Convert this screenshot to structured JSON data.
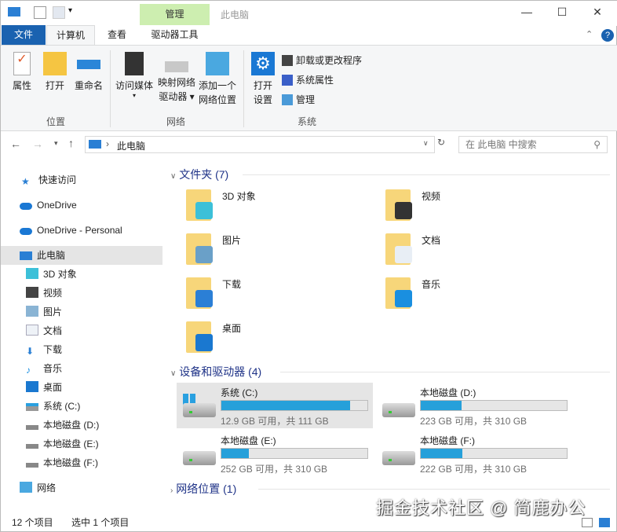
{
  "title_bar": {
    "contextual_tab_group": "管理",
    "window_title": "此电脑",
    "minimize": "—",
    "maximize": "☐",
    "close": "✕"
  },
  "ribbon_tabs": {
    "file": "文件",
    "computer": "计算机",
    "view": "查看",
    "drive_tools": "驱动器工具"
  },
  "ribbon": {
    "location": {
      "label": "位置",
      "properties": "属性",
      "open": "打开",
      "rename": "重命名"
    },
    "network": {
      "label": "网络",
      "access_media": "访问媒体",
      "map_drive_1": "映射网络",
      "map_drive_2": "驱动器",
      "add_location_1": "添加一个",
      "add_location_2": "网络位置"
    },
    "system": {
      "label": "系统",
      "open_settings_1": "打开",
      "open_settings_2": "设置",
      "uninstall": "卸载或更改程序",
      "system_properties": "系统属性",
      "manage": "管理"
    }
  },
  "address": {
    "path": "此电脑",
    "search_placeholder": "在 此电脑 中搜索"
  },
  "nav": {
    "items": [
      {
        "label": "快速访问"
      },
      {
        "label": "OneDrive"
      },
      {
        "label": "OneDrive - Personal"
      },
      {
        "label": "此电脑"
      },
      {
        "label": "3D 对象"
      },
      {
        "label": "视频"
      },
      {
        "label": "图片"
      },
      {
        "label": "文档"
      },
      {
        "label": "下载"
      },
      {
        "label": "音乐"
      },
      {
        "label": "桌面"
      },
      {
        "label": "系统 (C:)"
      },
      {
        "label": "本地磁盘 (D:)"
      },
      {
        "label": "本地磁盘 (E:)"
      },
      {
        "label": "本地磁盘 (F:)"
      },
      {
        "label": "网络"
      }
    ]
  },
  "folders": {
    "header": "文件夹 (7)",
    "items": [
      {
        "name": "3D 对象",
        "color": "#3cc0d8"
      },
      {
        "name": "视频",
        "color": "#333"
      },
      {
        "name": "图片",
        "color": "#6aa0c8"
      },
      {
        "name": "文档",
        "color": "#e8eef5"
      },
      {
        "name": "下载",
        "color": "#2b7fd6"
      },
      {
        "name": "音乐",
        "color": "#1a8fe0"
      },
      {
        "name": "桌面",
        "color": "#1a78d0"
      }
    ]
  },
  "drives": {
    "header": "设备和驱动器 (4)",
    "items": [
      {
        "name": "系统 (C:)",
        "free": "12.9 GB 可用，共 111 GB",
        "used_pct": 88.4
      },
      {
        "name": "本地磁盘 (D:)",
        "free": "223 GB 可用，共 310 GB",
        "used_pct": 28.1
      },
      {
        "name": "本地磁盘 (E:)",
        "free": "252 GB 可用，共 310 GB",
        "used_pct": 18.7
      },
      {
        "name": "本地磁盘 (F:)",
        "free": "222 GB 可用，共 310 GB",
        "used_pct": 28.4
      }
    ]
  },
  "network_locations": {
    "header": "网络位置 (1)"
  },
  "status": {
    "item_count": "12 个项目",
    "selected": "选中 1 个项目"
  },
  "watermark": "掘金技术社区 @ 简鹿办公"
}
